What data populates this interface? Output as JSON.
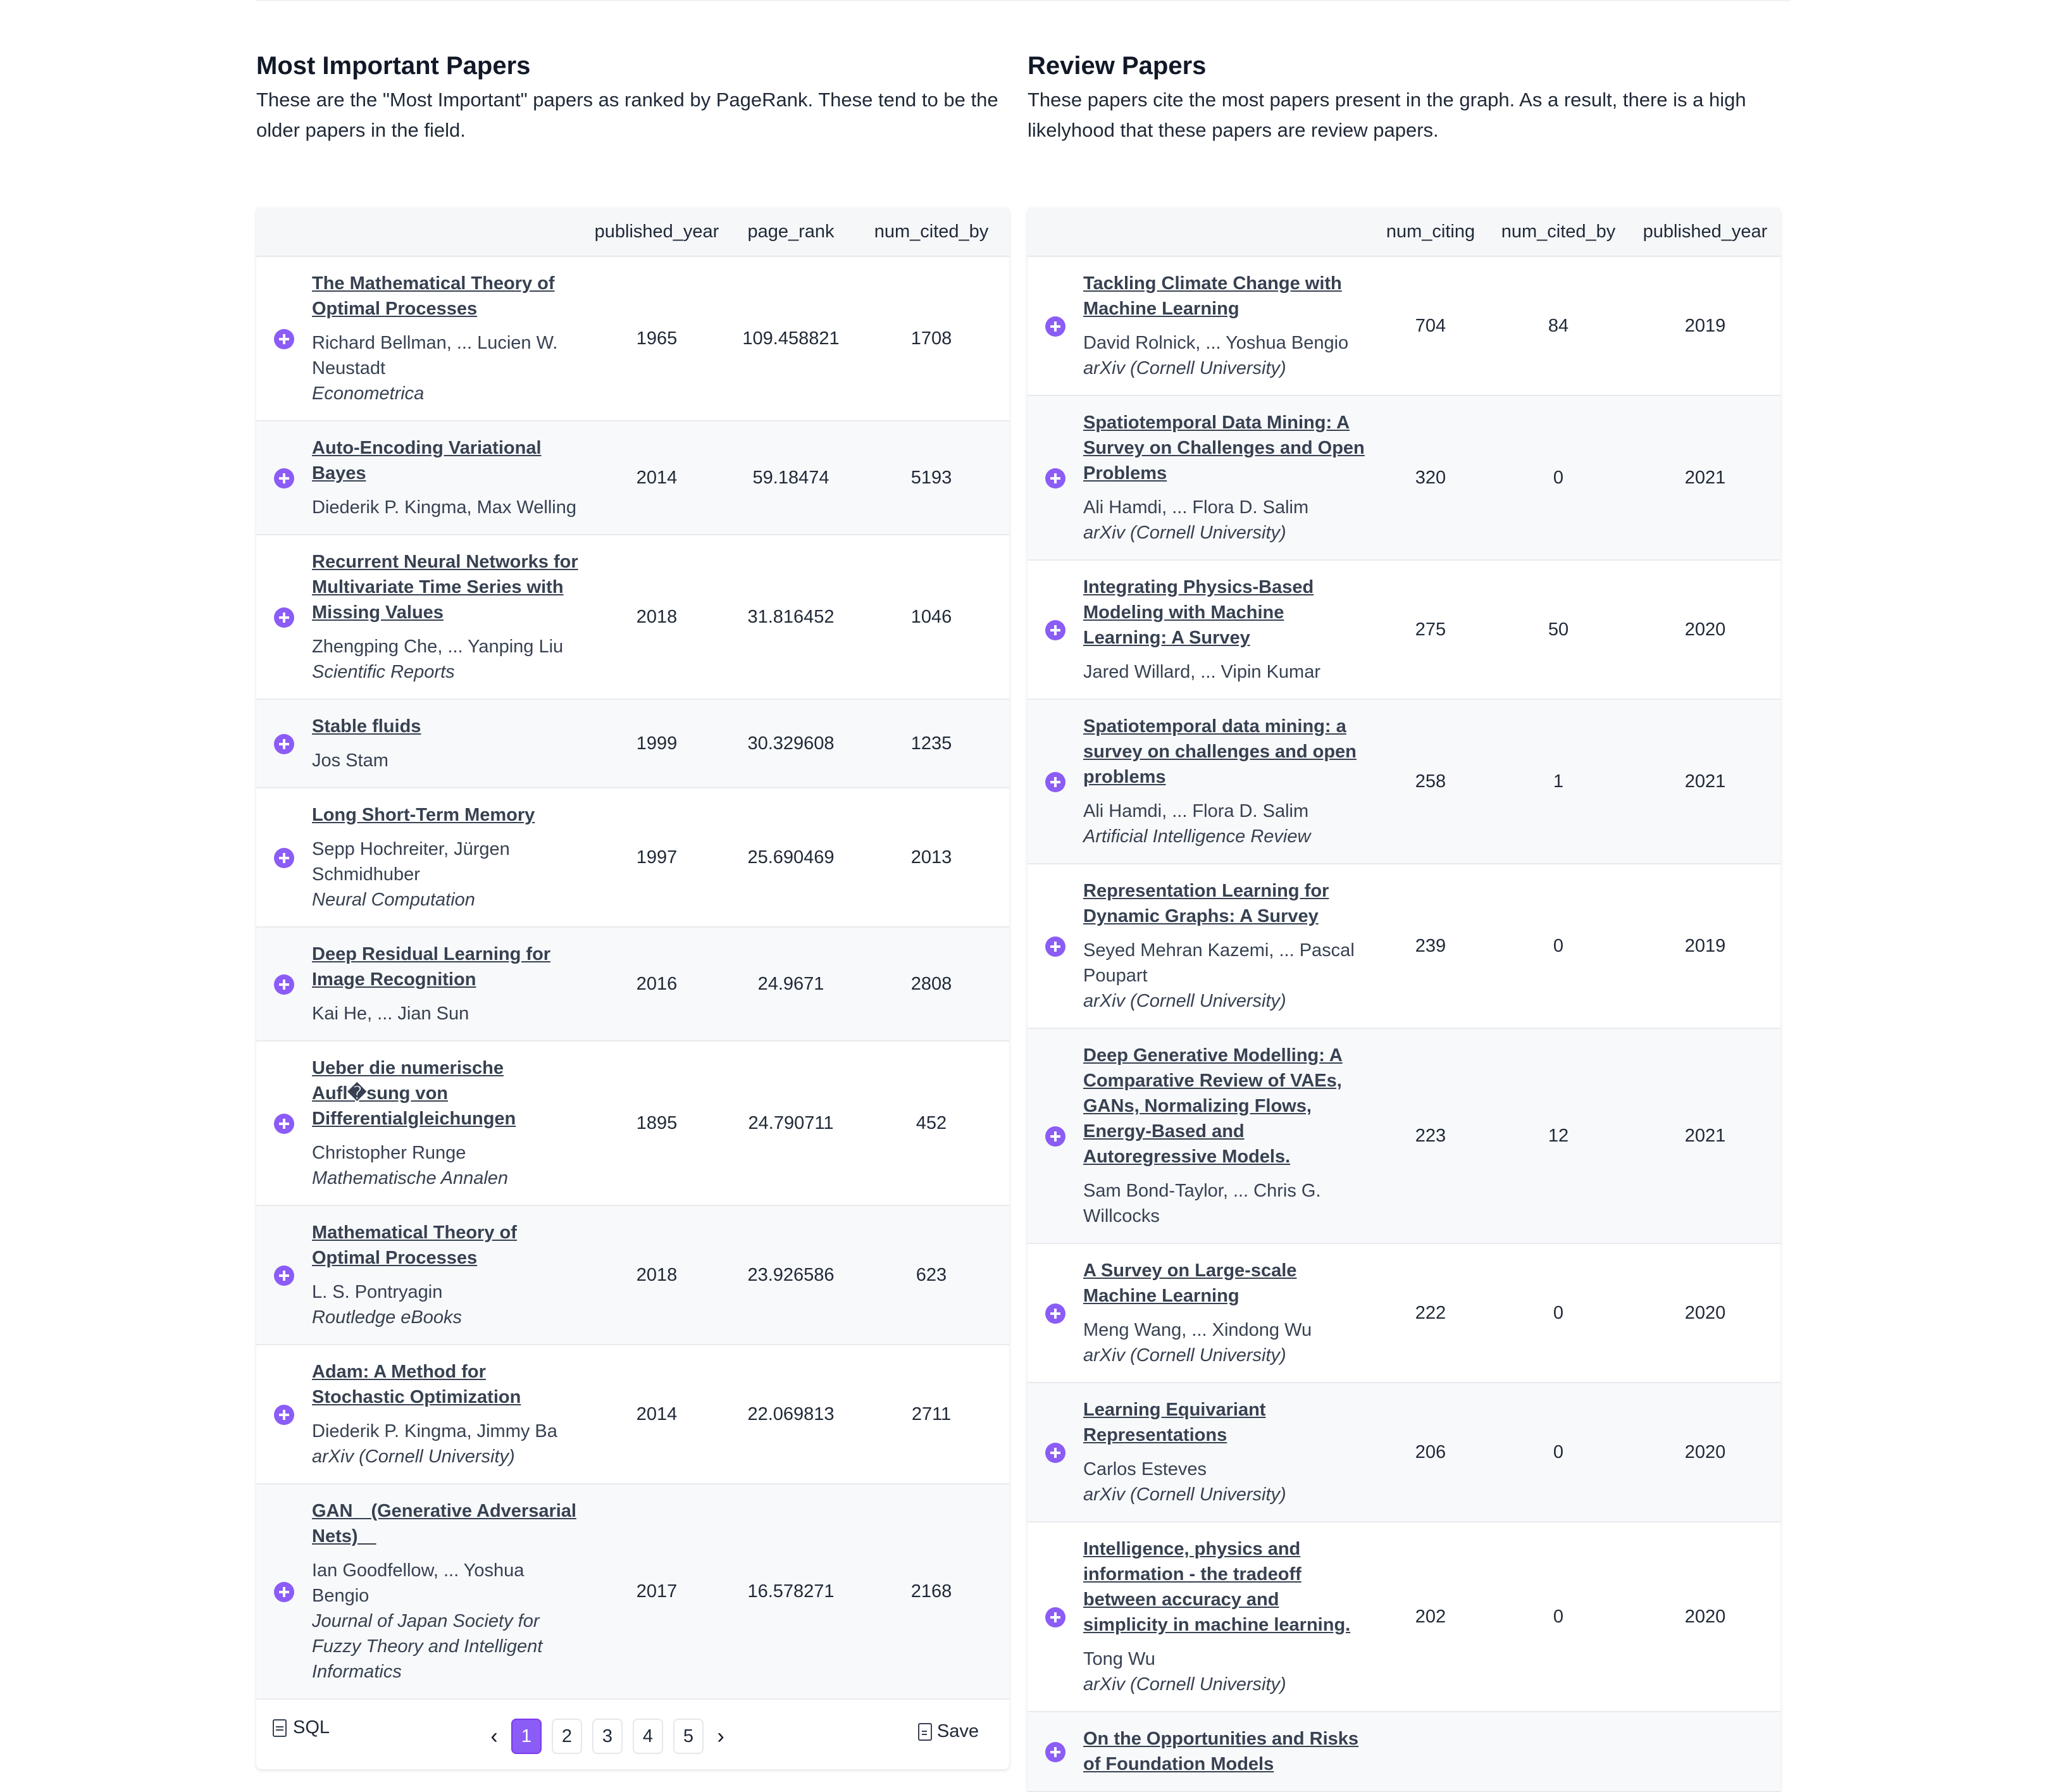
{
  "left_panel": {
    "title": "Most Important Papers",
    "description": "These are the \"Most Important\" papers as ranked by PageRank. These tend to be the older papers in the field.",
    "columns": [
      "",
      "published_year",
      "page_rank",
      "num_cited_by"
    ],
    "rows": [
      {
        "title": "The Mathematical Theory of Optimal Processes",
        "authors": "Richard Bellman, ... Lucien W. Neustadt",
        "venue": "Econometrica",
        "published_year": "1965",
        "page_rank": "109.458821",
        "num_cited_by": "1708"
      },
      {
        "title": "Auto-Encoding Variational Bayes",
        "authors": "Diederik P. Kingma, Max Welling",
        "venue": "",
        "published_year": "2014",
        "page_rank": "59.18474",
        "num_cited_by": "5193"
      },
      {
        "title": "Recurrent Neural Networks for Multivariate Time Series with Missing Values",
        "authors": "Zhengping Che, ... Yanping Liu",
        "venue": "Scientific Reports",
        "published_year": "2018",
        "page_rank": "31.816452",
        "num_cited_by": "1046"
      },
      {
        "title": "Stable fluids",
        "authors": "Jos Stam",
        "venue": "",
        "published_year": "1999",
        "page_rank": "30.329608",
        "num_cited_by": "1235"
      },
      {
        "title": "Long Short-Term Memory",
        "authors": "Sepp Hochreiter, Jürgen Schmidhuber",
        "venue": "Neural Computation",
        "published_year": "1997",
        "page_rank": "25.690469",
        "num_cited_by": "2013"
      },
      {
        "title": "Deep Residual Learning for Image Recognition",
        "authors": "Kai He, ... Jian Sun",
        "venue": "",
        "published_year": "2016",
        "page_rank": "24.9671",
        "num_cited_by": "2808"
      },
      {
        "title": "Ueber die numerische Aufl�sung von Differentialgleichungen",
        "authors": "Christopher Runge",
        "venue": "Mathematische Annalen",
        "published_year": "1895",
        "page_rank": "24.790711",
        "num_cited_by": "452"
      },
      {
        "title": "Mathematical Theory of Optimal Processes",
        "authors": "L. S. Pontryagin",
        "venue": "Routledge eBooks",
        "published_year": "2018",
        "page_rank": "23.926586",
        "num_cited_by": "623"
      },
      {
        "title": "Adam: A Method for Stochastic Optimization",
        "authors": "Diederik P. Kingma, Jimmy Ba",
        "venue": "arXiv (Cornell University)",
        "published_year": "2014",
        "page_rank": "22.069813",
        "num_cited_by": "2711"
      },
      {
        "title": "GAN　(Generative Adversarial Nets)　",
        "authors": "Ian Goodfellow, ... Yoshua Bengio",
        "venue": "Journal of Japan Society for Fuzzy Theory and Intelligent Informatics",
        "published_year": "2017",
        "page_rank": "16.578271",
        "num_cited_by": "2168"
      }
    ],
    "footer": {
      "sql_label": "SQL",
      "pages": [
        "1",
        "2",
        "3",
        "4",
        "5"
      ],
      "active_page": "1",
      "prev_label": "‹",
      "next_label": "›",
      "save_label": "Save"
    }
  },
  "right_panel": {
    "title": "Review Papers",
    "description": "These papers cite the most papers present in the graph. As a result, there is a high likelyhood that these papers are review papers.",
    "columns": [
      "",
      "num_citing",
      "num_cited_by",
      "published_year"
    ],
    "rows": [
      {
        "title": "Tackling Climate Change with Machine Learning",
        "authors": "David Rolnick, ... Yoshua Bengio",
        "venue": "arXiv (Cornell University)",
        "num_citing": "704",
        "num_cited_by": "84",
        "published_year": "2019"
      },
      {
        "title": "Spatiotemporal Data Mining: A Survey on Challenges and Open Problems",
        "authors": "Ali Hamdi, ... Flora D. Salim",
        "venue": "arXiv (Cornell University)",
        "num_citing": "320",
        "num_cited_by": "0",
        "published_year": "2021"
      },
      {
        "title": "Integrating Physics-Based Modeling with Machine Learning: A Survey",
        "authors": "Jared Willard, ... Vipin Kumar",
        "venue": "",
        "num_citing": "275",
        "num_cited_by": "50",
        "published_year": "2020"
      },
      {
        "title": "Spatiotemporal data mining: a survey on challenges and open problems",
        "authors": "Ali Hamdi, ... Flora D. Salim",
        "venue": "Artificial Intelligence Review",
        "num_citing": "258",
        "num_cited_by": "1",
        "published_year": "2021"
      },
      {
        "title": "Representation Learning for Dynamic Graphs: A Survey",
        "authors": "Seyed Mehran Kazemi, ... Pascal Poupart",
        "venue": "arXiv (Cornell University)",
        "num_citing": "239",
        "num_cited_by": "0",
        "published_year": "2019"
      },
      {
        "title": "Deep Generative Modelling: A Comparative Review of VAEs, GANs, Normalizing Flows, Energy-Based and Autoregressive Models.",
        "authors": "Sam Bond-Taylor, ... Chris G. Willcocks",
        "venue": "",
        "num_citing": "223",
        "num_cited_by": "12",
        "published_year": "2021"
      },
      {
        "title": "A Survey on Large-scale Machine Learning",
        "authors": "Meng Wang, ... Xindong Wu",
        "venue": "arXiv (Cornell University)",
        "num_citing": "222",
        "num_cited_by": "0",
        "published_year": "2020"
      },
      {
        "title": "Learning Equivariant Representations",
        "authors": "Carlos Esteves",
        "venue": "arXiv (Cornell University)",
        "num_citing": "206",
        "num_cited_by": "0",
        "published_year": "2020"
      },
      {
        "title": "Intelligence, physics and information - the tradeoff between accuracy and simplicity in machine learning.",
        "authors": "Tong Wu",
        "venue": "arXiv (Cornell University)",
        "num_citing": "202",
        "num_cited_by": "0",
        "published_year": "2020"
      },
      {
        "title": "On the Opportunities and Risks of Foundation Models",
        "authors": "",
        "venue": "",
        "num_citing": "",
        "num_cited_by": "",
        "published_year": ""
      }
    ]
  }
}
